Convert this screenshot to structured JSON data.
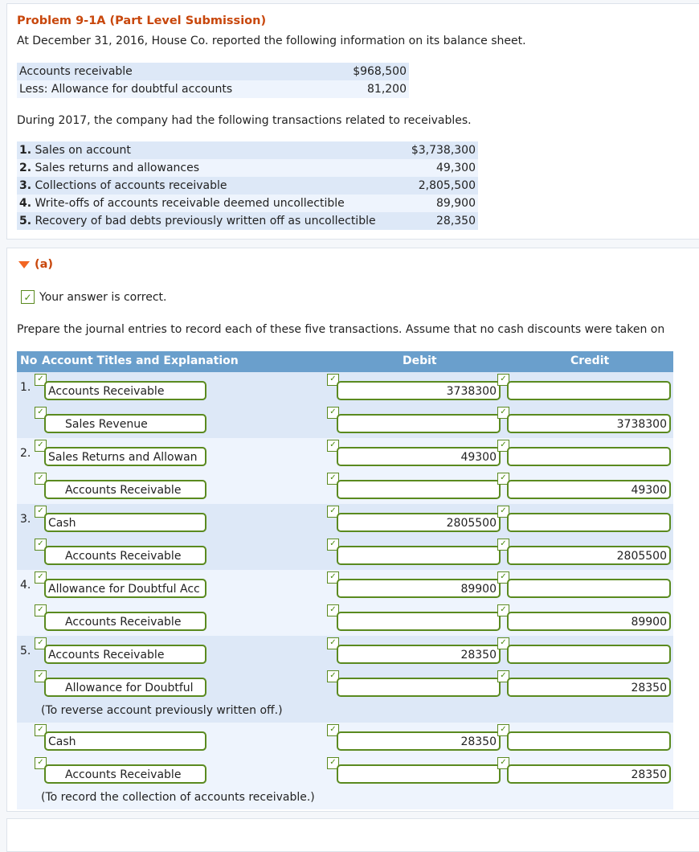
{
  "problem": {
    "title": "Problem 9-1A (Part Level Submission)",
    "intro": "At December 31, 2016, House Co. reported the following information on its balance sheet.",
    "balance_sheet": [
      {
        "label": "Accounts receivable",
        "amount": "$968,500"
      },
      {
        "label": "Less: Allowance for doubtful accounts",
        "amount": "81,200"
      }
    ],
    "intro2": "During 2017, the company had the following transactions related to receivables.",
    "transactions": [
      {
        "num": "1.",
        "label": "Sales on account",
        "amount": "$3,738,300"
      },
      {
        "num": "2.",
        "label": "Sales returns and allowances",
        "amount": "49,300"
      },
      {
        "num": "3.",
        "label": "Collections of accounts receivable",
        "amount": "2,805,500"
      },
      {
        "num": "4.",
        "label": "Write-offs of accounts receivable deemed uncollectible",
        "amount": "89,900"
      },
      {
        "num": "5.",
        "label": "Recovery of bad debts previously written off as uncollectible",
        "amount": "28,350"
      }
    ]
  },
  "part_a": {
    "label": "(a)",
    "status": "Your answer is correct.",
    "instructions": "Prepare the journal entries to record each of these five transactions. Assume that no cash discounts were taken on",
    "columns": {
      "no": "No",
      "account": "Account Titles and Explanation",
      "debit": "Debit",
      "credit": "Credit"
    },
    "check_glyph": "✓",
    "entries": [
      {
        "num": "1.",
        "lines": [
          {
            "account": "Accounts Receivable",
            "indent": false,
            "debit": "3738300",
            "credit": ""
          },
          {
            "account": "Sales Revenue",
            "indent": true,
            "debit": "",
            "credit": "3738300"
          }
        ]
      },
      {
        "num": "2.",
        "lines": [
          {
            "account": "Sales Returns and Allowan",
            "indent": false,
            "debit": "49300",
            "credit": ""
          },
          {
            "account": "Accounts Receivable",
            "indent": true,
            "debit": "",
            "credit": "49300"
          }
        ]
      },
      {
        "num": "3.",
        "lines": [
          {
            "account": "Cash",
            "indent": false,
            "debit": "2805500",
            "credit": ""
          },
          {
            "account": "Accounts Receivable",
            "indent": true,
            "debit": "",
            "credit": "2805500"
          }
        ]
      },
      {
        "num": "4.",
        "lines": [
          {
            "account": "Allowance for Doubtful Acc",
            "indent": false,
            "debit": "89900",
            "credit": ""
          },
          {
            "account": "Accounts Receivable",
            "indent": true,
            "debit": "",
            "credit": "89900"
          }
        ]
      },
      {
        "num": "5.",
        "lines": [
          {
            "account": "Accounts Receivable",
            "indent": false,
            "debit": "28350",
            "credit": ""
          },
          {
            "account": "Allowance for Doubtful ",
            "indent": true,
            "debit": "",
            "credit": "28350"
          }
        ],
        "explanation": "(To reverse account previously written off.)"
      },
      {
        "num": "",
        "lines": [
          {
            "account": "Cash",
            "indent": false,
            "debit": "28350",
            "credit": ""
          },
          {
            "account": "Accounts Receivable",
            "indent": true,
            "debit": "",
            "credit": "28350"
          }
        ],
        "explanation": "(To record the collection of accounts receivable.)"
      }
    ]
  }
}
